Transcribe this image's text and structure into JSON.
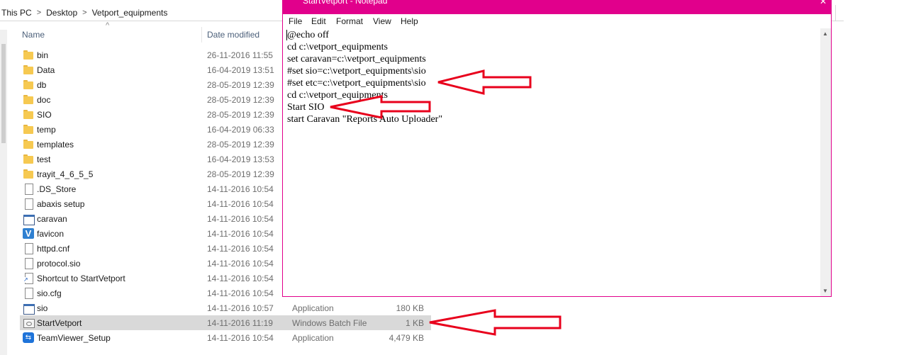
{
  "explorer": {
    "breadcrumb": [
      "This PC",
      "Desktop",
      "Vetport_equipments"
    ],
    "separator": ">",
    "columns": {
      "name": "Name",
      "date_modified": "Date modified"
    },
    "sort_indicator": "^",
    "files": [
      {
        "name": "bin",
        "date": "26-11-2016 11:55",
        "type": "",
        "size": "",
        "icon": "folder-icon"
      },
      {
        "name": "Data",
        "date": "16-04-2019 13:51",
        "type": "",
        "size": "",
        "icon": "folder-icon"
      },
      {
        "name": "db",
        "date": "28-05-2019 12:39",
        "type": "",
        "size": "",
        "icon": "folder-icon"
      },
      {
        "name": "doc",
        "date": "28-05-2019 12:39",
        "type": "",
        "size": "",
        "icon": "folder-icon"
      },
      {
        "name": "SIO",
        "date": "28-05-2019 12:39",
        "type": "",
        "size": "",
        "icon": "folder-icon"
      },
      {
        "name": "temp",
        "date": "16-04-2019 06:33",
        "type": "",
        "size": "",
        "icon": "folder-icon"
      },
      {
        "name": "templates",
        "date": "28-05-2019 12:39",
        "type": "",
        "size": "",
        "icon": "folder-icon"
      },
      {
        "name": "test",
        "date": "16-04-2019 13:53",
        "type": "",
        "size": "",
        "icon": "folder-icon"
      },
      {
        "name": "trayit_4_6_5_5",
        "date": "28-05-2019 12:39",
        "type": "",
        "size": "",
        "icon": "folder-icon"
      },
      {
        "name": ".DS_Store",
        "date": "14-11-2016 10:54",
        "type": "",
        "size": "",
        "icon": "file-icon"
      },
      {
        "name": "abaxis setup",
        "date": "14-11-2016 10:54",
        "type": "",
        "size": "",
        "icon": "file-icon"
      },
      {
        "name": "caravan",
        "date": "14-11-2016 10:54",
        "type": "",
        "size": "",
        "icon": "application-icon"
      },
      {
        "name": "favicon",
        "date": "14-11-2016 10:54",
        "type": "",
        "size": "",
        "icon": "vetport-icon"
      },
      {
        "name": "httpd.cnf",
        "date": "14-11-2016 10:54",
        "type": "",
        "size": "",
        "icon": "file-icon"
      },
      {
        "name": "protocol.sio",
        "date": "14-11-2016 10:54",
        "type": "",
        "size": "",
        "icon": "file-icon"
      },
      {
        "name": "Shortcut to StartVetport",
        "date": "14-11-2016 10:54",
        "type": "",
        "size": "",
        "icon": "shortcut-icon"
      },
      {
        "name": "sio.cfg",
        "date": "14-11-2016 10:54",
        "type": "",
        "size": "",
        "icon": "file-icon"
      },
      {
        "name": "sio",
        "date": "14-11-2016 10:57",
        "type": "Application",
        "size": "180 KB",
        "icon": "application-icon"
      },
      {
        "name": "StartVetport",
        "date": "14-11-2016 11:19",
        "type": "Windows Batch File",
        "size": "1 KB",
        "icon": "batch-file-icon",
        "selected": true
      },
      {
        "name": "TeamViewer_Setup",
        "date": "14-11-2016 10:54",
        "type": "Application",
        "size": "4,479 KB",
        "icon": "teamviewer-icon"
      }
    ]
  },
  "notepad": {
    "title": "StartVetport - Notepad",
    "close_glyph": "✕",
    "menu": [
      "File",
      "Edit",
      "Format",
      "View",
      "Help"
    ],
    "lines": [
      "@echo off",
      "cd c:\\vetport_equipments",
      "set caravan=c:\\vetport_equipments",
      "#set sio=c:\\vetport_equipments\\sio",
      "#set etc=c:\\vetport_equipments\\sio",
      "cd c:\\vetport_equipments",
      "Start SIO",
      "start Caravan \"Reports Auto Uploader\""
    ],
    "scroll_up": "▲",
    "scroll_down": "▼"
  },
  "annotations": {
    "arrow_color": "#e8001c"
  },
  "colors": {
    "notepad_border": "#e1008c",
    "selected_row": "#d9d9d9"
  }
}
